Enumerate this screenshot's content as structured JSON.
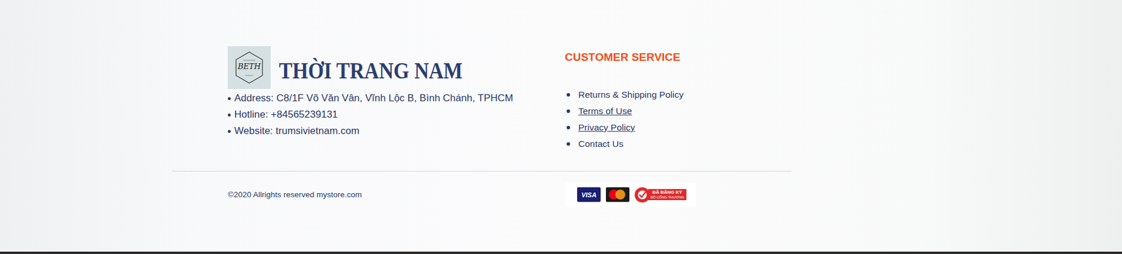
{
  "brand": {
    "logo_text": "BETH",
    "name": "THỜI TRANG NAM"
  },
  "contact": [
    "Address: C8/1F Võ Văn Vân, Vĩnh Lộc B, Bình Chánh, TPHCM",
    "Hotline: +84565239131",
    "Website: trumsivietnam.com"
  ],
  "customer_service": {
    "title": "CUSTOMER SERVICE",
    "links": [
      {
        "label": "Returns & Shipping Policy",
        "underlined": false
      },
      {
        "label": "Terms of Use",
        "underlined": true
      },
      {
        "label": "Privacy Policy",
        "underlined": true
      },
      {
        "label": "Contact Us",
        "underlined": false
      }
    ]
  },
  "copyright": "©2020 Allrights reserved mystore.com",
  "payments": {
    "visa": "VISA",
    "registered": "ĐÃ ĐĂNG KÝ",
    "registered_sub": "BỘ CÔNG THƯƠNG"
  }
}
